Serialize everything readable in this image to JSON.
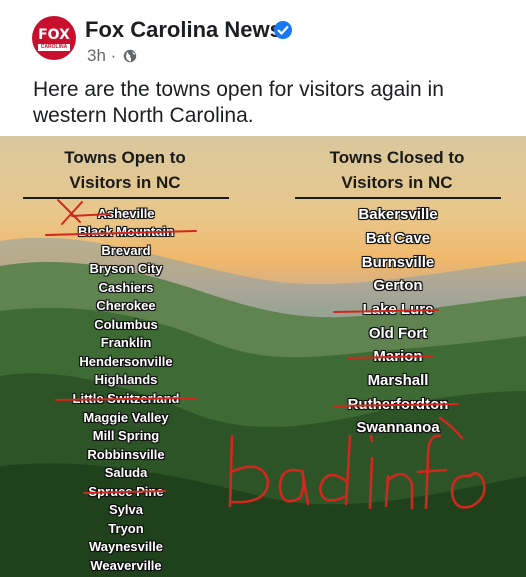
{
  "page": {
    "name": "Fox Carolina News",
    "time": "3h",
    "separator": "·",
    "logo_text": "FOX",
    "logo_subtext": "CAROLINA"
  },
  "post": {
    "text": "Here are the towns open for visitors again in western North Carolina."
  },
  "image": {
    "open": {
      "title_line1": "Towns Open to",
      "title_line2": "Visitors in NC",
      "towns": [
        "Asheville",
        "Black Mountain",
        "Brevard",
        "Bryson City",
        "Cashiers",
        "Cherokee",
        "Columbus",
        "Franklin",
        "Hendersonville",
        "Highlands",
        "Little Switzerland",
        "Maggie Valley",
        "Mill Spring",
        "Robbinsville",
        "Saluda",
        "Spruce Pine",
        "Sylva",
        "Tryon",
        "Waynesville",
        "Weaverville"
      ]
    },
    "closed": {
      "title_line1": "Towns Closed to",
      "title_line2": "Visitors in NC",
      "towns": [
        "Bakersville",
        "Bat Cave",
        "Burnsville",
        "Gerton",
        "Lake Lure",
        "Old Fort",
        "Marion",
        "Marshall",
        "Rutherfordton",
        "Swannanoa"
      ]
    },
    "annotation": "bad info"
  },
  "colors": {
    "brand_red": "#c8102e",
    "verified_blue": "#1877f2",
    "ink_red": "#d0281e"
  },
  "icons": [
    "verified-badge-icon",
    "globe-icon"
  ]
}
